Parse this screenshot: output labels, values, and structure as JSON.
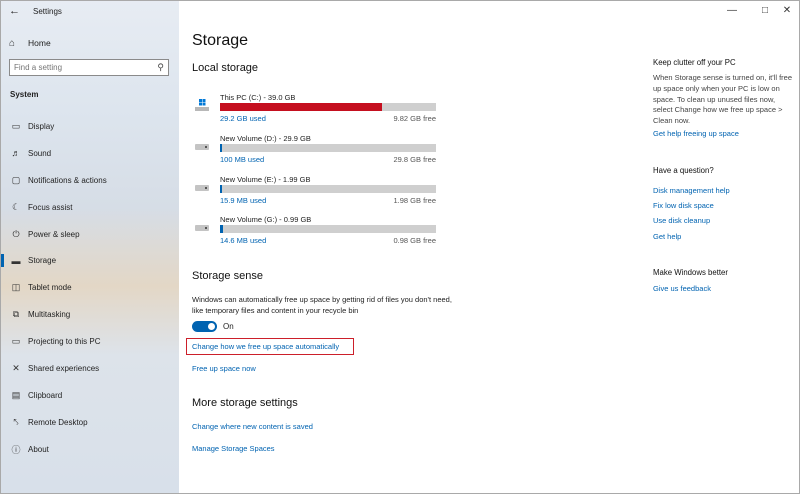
{
  "app": {
    "title": "Settings"
  },
  "titlebar": {
    "minimize_icon": "minimize-icon",
    "maximize_icon": "maximize-icon",
    "close_icon": "close-icon"
  },
  "sidebar": {
    "home_label": "Home",
    "search_placeholder": "Find a setting",
    "section_label": "System",
    "items": [
      {
        "label": "Display",
        "icon": "display-icon"
      },
      {
        "label": "Sound",
        "icon": "sound-icon"
      },
      {
        "label": "Notifications & actions",
        "icon": "notifications-icon"
      },
      {
        "label": "Focus assist",
        "icon": "focus-assist-icon"
      },
      {
        "label": "Power & sleep",
        "icon": "power-icon"
      },
      {
        "label": "Storage",
        "icon": "storage-icon",
        "active": true
      },
      {
        "label": "Tablet mode",
        "icon": "tablet-icon"
      },
      {
        "label": "Multitasking",
        "icon": "multitasking-icon"
      },
      {
        "label": "Projecting to this PC",
        "icon": "projecting-icon"
      },
      {
        "label": "Shared experiences",
        "icon": "shared-icon"
      },
      {
        "label": "Clipboard",
        "icon": "clipboard-icon"
      },
      {
        "label": "Remote Desktop",
        "icon": "remote-desktop-icon"
      },
      {
        "label": "About",
        "icon": "about-icon"
      }
    ]
  },
  "main": {
    "title": "Storage",
    "local_storage": {
      "heading": "Local storage",
      "drives": [
        {
          "name": "This PC (C:) - 39.0 GB",
          "used": "29.2 GB used",
          "free": "9.82 GB free",
          "used_fraction": 0.75,
          "color": "#c50f1f"
        },
        {
          "name": "New Volume (D:) - 29.9 GB",
          "used": "100 MB used",
          "free": "29.8 GB free",
          "used_fraction": 0.003,
          "color": "#0063b1"
        },
        {
          "name": "New Volume (E:) - 1.99 GB",
          "used": "15.9 MB used",
          "free": "1.98 GB free",
          "used_fraction": 0.008,
          "color": "#0063b1"
        },
        {
          "name": "New Volume (G:) - 0.99 GB",
          "used": "14.6 MB used",
          "free": "0.98 GB free",
          "used_fraction": 0.015,
          "color": "#0063b1"
        }
      ]
    },
    "storage_sense": {
      "heading": "Storage sense",
      "description": "Windows can automatically free up space by getting rid of files you don't need, like temporary files and content in your recycle bin",
      "toggle_label": "On",
      "toggle_on": true,
      "change_link": "Change how we free up space automatically",
      "free_link": "Free up space now"
    },
    "more_settings": {
      "heading": "More storage settings",
      "links": [
        "Change where new content is saved",
        "Manage Storage Spaces"
      ]
    }
  },
  "right_panel": {
    "clutter_title": "Keep clutter off your PC",
    "clutter_text": "When Storage sense is turned on, it'll free up space only when your PC is low on space. To clean up unused files now, select Change how we free up space > Clean now.",
    "clutter_link": "Get help freeing up space",
    "question_title": "Have a question?",
    "question_links": [
      "Disk management help",
      "Fix low disk space",
      "Use disk cleanup",
      "Get help"
    ],
    "better_title": "Make Windows better",
    "better_link": "Give us feedback"
  },
  "colors": {
    "accent": "#0063b1",
    "warning_bar": "#c50f1f",
    "highlight_box": "#cc1f2a"
  }
}
